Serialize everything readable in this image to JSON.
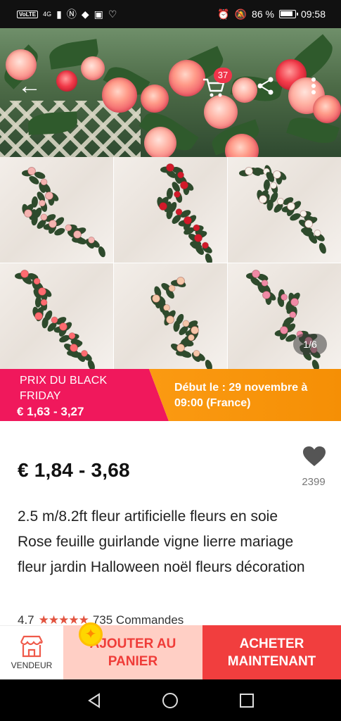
{
  "status_bar": {
    "left_chip": "VoLTE",
    "signal": "4G",
    "right_text": "86 %",
    "time": "09:58"
  },
  "hero": {
    "cart_badge": "37"
  },
  "gallery": {
    "page_indicator": "1/6",
    "tiles": [
      {
        "rose_color": "#f4b3b0"
      },
      {
        "rose_color": "#d21a2a"
      },
      {
        "rose_color": "#f7f2ea"
      },
      {
        "rose_color": "#ff6b70"
      },
      {
        "rose_color": "#f5c6a8"
      },
      {
        "rose_color": "#f08aa6"
      }
    ]
  },
  "promo": {
    "title_line1": "PRIX DU BLACK",
    "title_line2": "FRIDAY",
    "price": "€ 1,63 - 3,27",
    "start_line1": "Début le : 29 novembre à",
    "start_line2": "09:00 (France)"
  },
  "product": {
    "price": "€ 1,84 - 3,68",
    "wishlist_count": "2399",
    "title": "2.5 m/8.2ft fleur artificielle fleurs en soie Rose feuille guirlande vigne lierre mariage fleur jardin Halloween noël fleurs décoration",
    "rating": "4.7",
    "orders": "735 Commandes"
  },
  "actions": {
    "seller_label": "VENDEUR",
    "add_to_cart_line1": "AJOUTER AU",
    "add_to_cart_line2": "PANIER",
    "buy_now_line1": "ACHETER",
    "buy_now_line2": "MAINTENANT"
  },
  "colors": {
    "promo_pink": "#f0185c",
    "promo_orange": "#f58f05",
    "buy_red": "#f13e3e",
    "add_cart_bg": "#ffcfc5"
  }
}
